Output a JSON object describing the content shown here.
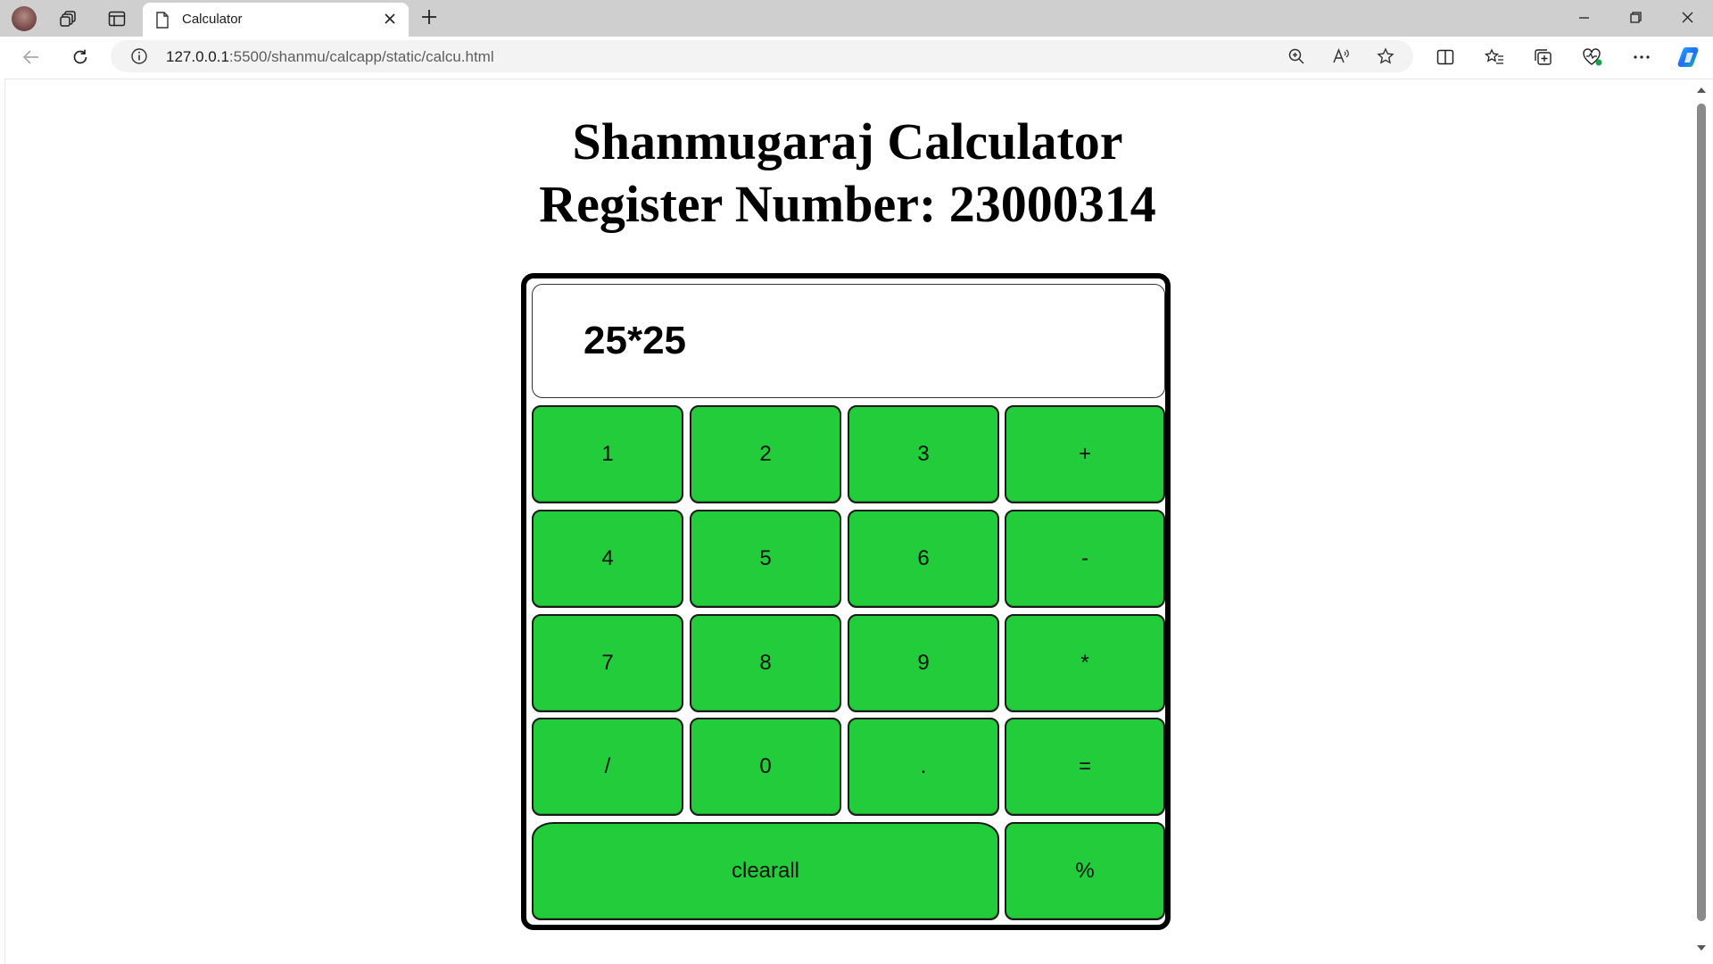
{
  "browser": {
    "tab_title": "Calculator",
    "url_host": "127.0.0.1",
    "url_path": ":5500/shanmu/calcapp/static/calcu.html"
  },
  "page": {
    "title_line1": "Shanmugaraj Calculator",
    "title_line2": "Register Number: 23000314",
    "display_value": "25*25"
  },
  "keys": {
    "k1": "1",
    "k2": "2",
    "k3": "3",
    "plus": "+",
    "k4": "4",
    "k5": "5",
    "k6": "6",
    "minus": "-",
    "k7": "7",
    "k8": "8",
    "k9": "9",
    "multiply": "*",
    "divide": "/",
    "k0": "0",
    "dot": ".",
    "equals": "=",
    "clear": "clearall",
    "percent": "%"
  },
  "colors": {
    "key_green": "#22cc3a",
    "border": "#000000"
  }
}
